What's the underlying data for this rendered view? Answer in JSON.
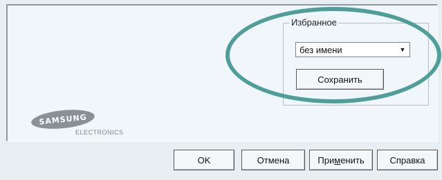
{
  "favorites": {
    "group_label": "Избранное",
    "selected_value": "без имени",
    "save_label": "Сохранить"
  },
  "logo": {
    "brand": "SAMSUNG",
    "sub": "ELECTRONICS"
  },
  "footer": {
    "ok_label": "OK",
    "cancel_label": "Отмена",
    "apply_label_pre": "При",
    "apply_label_ul": "м",
    "apply_label_post": "енить",
    "help_label": "Справка"
  },
  "colors": {
    "highlight_ring": "#4f9e9a",
    "logo_gray": "#8a9196"
  },
  "icons": {
    "dropdown": "chevron-down-icon"
  }
}
